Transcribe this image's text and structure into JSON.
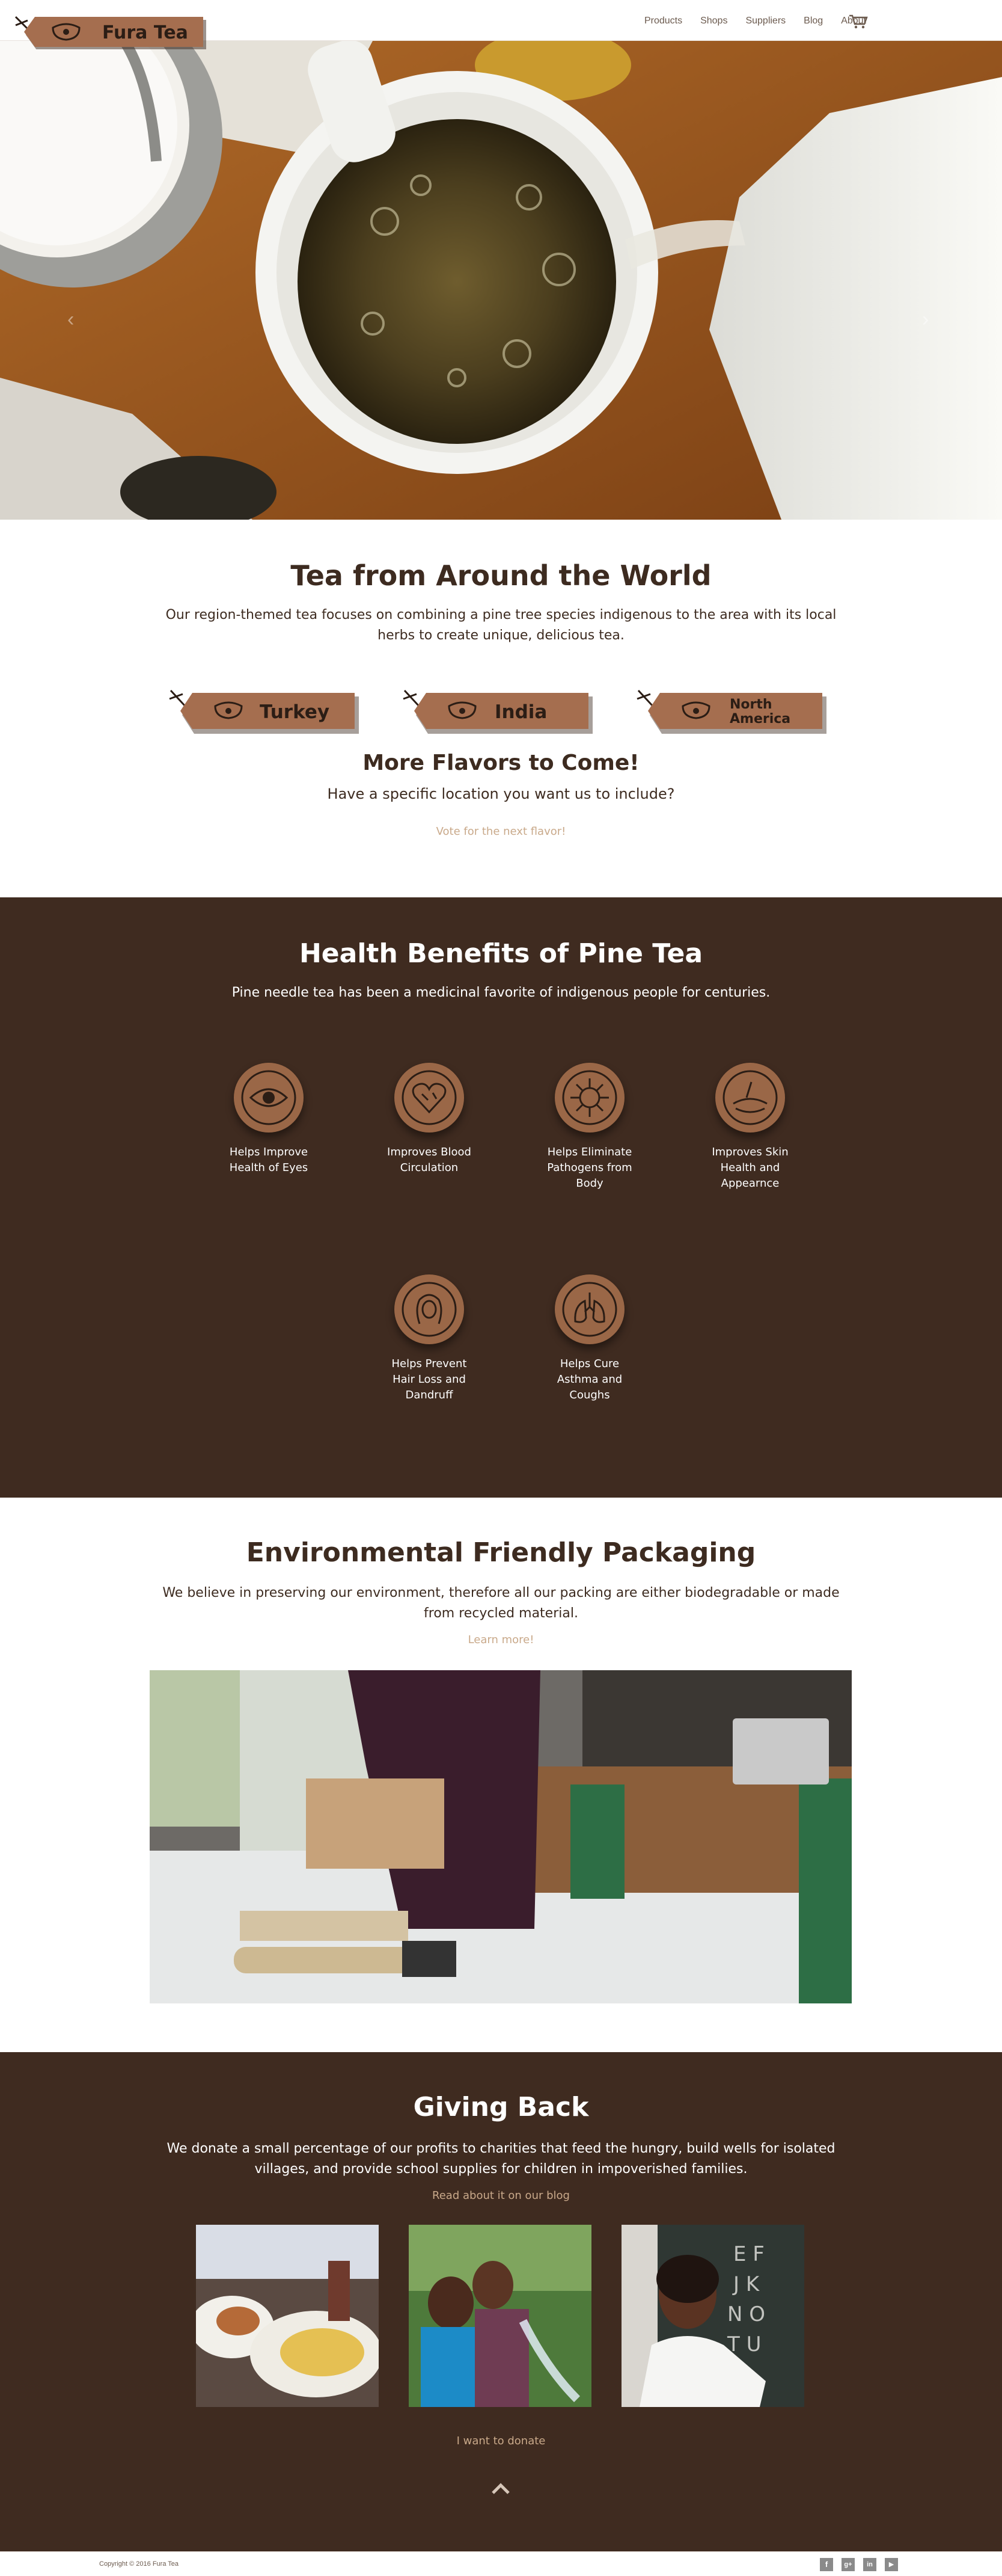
{
  "brand": {
    "name": "Fura Tea"
  },
  "nav": {
    "items": [
      {
        "label": "Products"
      },
      {
        "label": "Shops"
      },
      {
        "label": "Suppliers"
      },
      {
        "label": "Blog"
      },
      {
        "label": "About"
      }
    ]
  },
  "hero": {
    "prev": "‹",
    "next": "›",
    "slides": 3,
    "active_slide": 1
  },
  "world": {
    "title": "Tea from Around the World",
    "text": "Our region-themed tea focuses on combining a pine tree species indigenous to the area with its local herbs to create unique, delicious tea.",
    "flavors": [
      {
        "label": "Turkey"
      },
      {
        "label": "India"
      },
      {
        "label_line1": "North",
        "label_line2": "America"
      }
    ],
    "more_title": "More Flavors to Come!",
    "more_text": "Have a specific location you want us to include?",
    "vote_link": "Vote for the next flavor!"
  },
  "health": {
    "title": "Health Benefits of Pine Tea",
    "text": "Pine needle tea has been a medicinal favorite of indigenous people for centuries.",
    "benefits": [
      {
        "line1": "Helps Improve",
        "line2": "Health of Eyes",
        "line3": "",
        "icon": "eye-icon"
      },
      {
        "line1": "Improves Blood",
        "line2": "Circulation",
        "line3": "",
        "icon": "heart-icon"
      },
      {
        "line1": "Helps Eliminate",
        "line2": "Pathogens from",
        "line3": "Body",
        "icon": "virus-icon"
      },
      {
        "line1": "Improves Skin",
        "line2": "Health and",
        "line3": "Appearnce",
        "icon": "skin-icon"
      },
      {
        "line1": "Helps Prevent",
        "line2": "Hair Loss and",
        "line3": "Dandruff",
        "icon": "hair-icon"
      },
      {
        "line1": "Helps Cure",
        "line2": "Asthma and",
        "line3": "Coughs",
        "icon": "lungs-icon"
      }
    ]
  },
  "packaging": {
    "title": "Environmental Friendly Packaging",
    "text": "We believe in preserving our environment, therefore all our packing are either biodegradable or made from recycled material.",
    "link": "Learn more!"
  },
  "giving": {
    "title": "Giving Back",
    "text": "We donate a small percentage of our profits to charities that feed the hungry, build wells for isolated villages, and provide school supplies for children in impoverished families.",
    "blog_link": "Read about it on our blog",
    "donate_link": "I want to donate"
  },
  "footer": {
    "copyright": "Copyright © 2016 Fura Tea",
    "social": [
      {
        "icon": "facebook-icon",
        "glyph": "f"
      },
      {
        "icon": "googleplus-icon",
        "glyph": "g+"
      },
      {
        "icon": "linkedin-icon",
        "glyph": "in"
      },
      {
        "icon": "youtube-icon",
        "glyph": "▶"
      }
    ]
  },
  "colors": {
    "brown": "#3f2b20",
    "tag": "#a56e4f",
    "link": "#c9a98a",
    "text": "#3d2b20"
  }
}
